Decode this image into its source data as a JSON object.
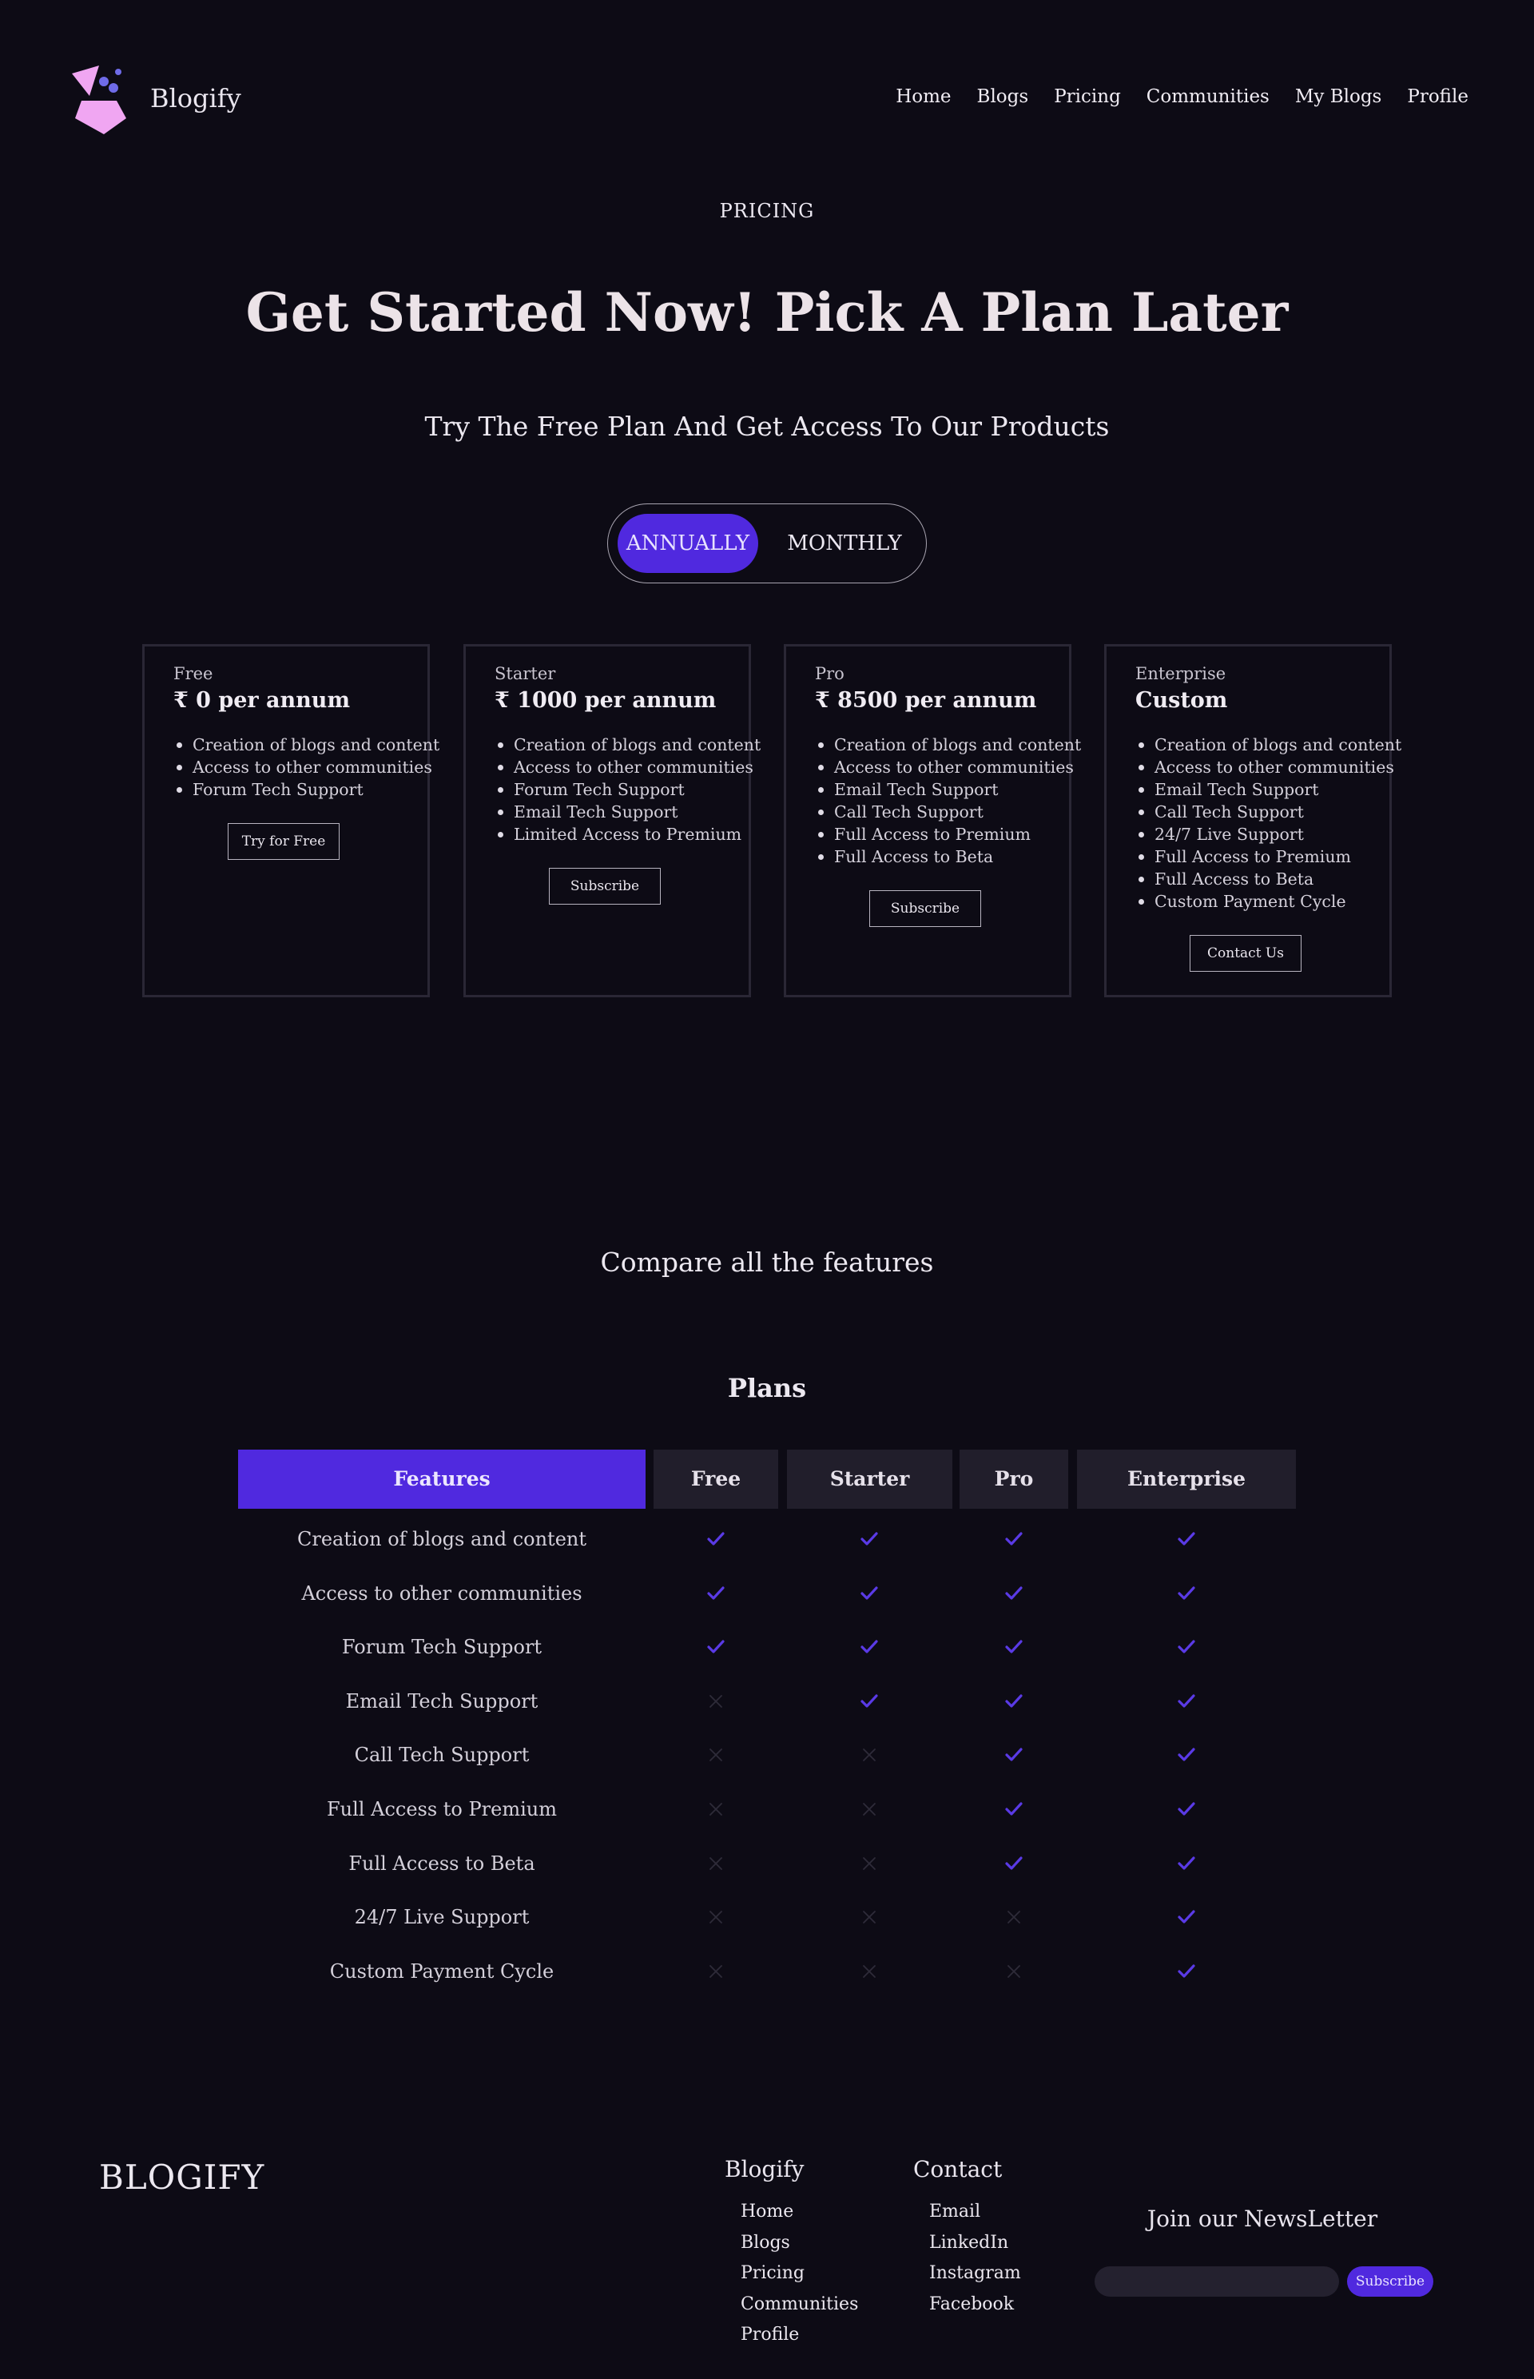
{
  "header": {
    "brand": "Blogify",
    "nav": [
      "Home",
      "Blogs",
      "Pricing",
      "Communities",
      "My Blogs",
      "Profile"
    ]
  },
  "hero": {
    "eyebrow": "PRICING",
    "title": "Get Started Now! Pick A Plan Later",
    "subtitle": "Try The Free Plan And Get Access To Our Products"
  },
  "billing_toggle": {
    "options": [
      "ANNUALLY",
      "MONTHLY"
    ],
    "selected": "ANNUALLY"
  },
  "plans": [
    {
      "name": "Free",
      "price": "₹ 0 per annum",
      "features": [
        "Creation of blogs and content",
        "Access to other communities",
        "Forum Tech Support"
      ],
      "button": "Try for Free"
    },
    {
      "name": "Starter",
      "price": "₹ 1000 per annum",
      "features": [
        "Creation of blogs and content",
        "Access to other communities",
        "Forum Tech Support",
        "Email Tech Support",
        "Limited Access to Premium"
      ],
      "button": "Subscribe"
    },
    {
      "name": "Pro",
      "price": "₹ 8500 per annum",
      "features": [
        "Creation of blogs and content",
        "Access to other communities",
        "Email Tech Support",
        "Call Tech Support",
        "Full Access to Premium",
        "Full Access to Beta"
      ],
      "button": "Subscribe"
    },
    {
      "name": "Enterprise",
      "price": "Custom",
      "features": [
        "Creation of blogs and content",
        "Access to other communities",
        "Email Tech Support",
        "Call Tech Support",
        "24/7 Live Support",
        "Full Access to Premium",
        "Full Access to Beta",
        "Custom Payment Cycle"
      ],
      "button": "Contact Us"
    }
  ],
  "compare": {
    "title": "Compare all the features",
    "table_title": "Plans",
    "columns": [
      "Features",
      "Free",
      "Starter",
      "Pro",
      "Enterprise"
    ],
    "rows": [
      {
        "feature": "Creation of blogs and content",
        "values": [
          true,
          true,
          true,
          true
        ]
      },
      {
        "feature": "Access to other communities",
        "values": [
          true,
          true,
          true,
          true
        ]
      },
      {
        "feature": "Forum Tech Support",
        "values": [
          true,
          true,
          true,
          true
        ]
      },
      {
        "feature": "Email Tech Support",
        "values": [
          false,
          true,
          true,
          true
        ]
      },
      {
        "feature": "Call Tech Support",
        "values": [
          false,
          false,
          true,
          true
        ]
      },
      {
        "feature": "Full Access to Premium",
        "values": [
          false,
          false,
          true,
          true
        ]
      },
      {
        "feature": "Full Access to Beta",
        "values": [
          false,
          false,
          true,
          true
        ]
      },
      {
        "feature": "24/7 Live Support",
        "values": [
          false,
          false,
          false,
          true
        ]
      },
      {
        "feature": "Custom Payment Cycle",
        "values": [
          false,
          false,
          false,
          true
        ]
      }
    ],
    "icons": {
      "yes": "check-icon",
      "no": "cross-icon"
    },
    "colors": {
      "check": "#5a3ae6",
      "cross": "#2e2b39"
    }
  },
  "footer": {
    "brand": "BLOGIFY",
    "columns": [
      {
        "heading": "Blogify",
        "links": [
          "Home",
          "Blogs",
          "Pricing",
          "Communities",
          "Profile"
        ]
      },
      {
        "heading": "Contact",
        "links": [
          "Email",
          "LinkedIn",
          "Instagram",
          "Facebook"
        ]
      }
    ],
    "newsletter": {
      "title": "Join our NewsLetter",
      "input_placeholder": "",
      "button": "Subscribe"
    }
  },
  "colors": {
    "background": "#0d0b15",
    "accent": "#5029df",
    "logo_pink": "#f0a6f2",
    "logo_blue": "#6f6be8"
  }
}
